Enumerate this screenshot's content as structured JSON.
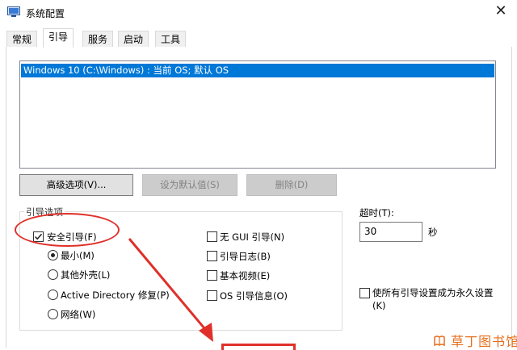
{
  "window": {
    "title": "系统配置",
    "close_glyph": "✕"
  },
  "tabs": [
    {
      "label": "常规"
    },
    {
      "label": "引导"
    },
    {
      "label": "服务"
    },
    {
      "label": "启动"
    },
    {
      "label": "工具"
    }
  ],
  "active_tab": "引导",
  "os_list": {
    "selected_item": "Windows 10 (C:\\Windows) : 当前 OS; 默认 OS"
  },
  "buttons": {
    "advanced": "高级选项(V)...",
    "set_default": "设为默认值(S)",
    "delete": "删除(D)"
  },
  "boot_options": {
    "group_label": "引导选项",
    "safe_boot": {
      "label": "安全引导(F)",
      "checked": true
    },
    "minimal": {
      "label": "最小(M)",
      "checked": true
    },
    "alternate_shell": {
      "label": "其他外壳(L)",
      "checked": false
    },
    "ad_repair": {
      "label": "Active Directory 修复(P)",
      "checked": false
    },
    "network": {
      "label": "网络(W)",
      "checked": false
    },
    "no_gui": {
      "label": "无 GUI 引导(N)",
      "checked": false
    },
    "boot_log": {
      "label": "引导日志(B)",
      "checked": false
    },
    "base_video": {
      "label": "基本视频(E)",
      "checked": false
    },
    "os_boot_info": {
      "label": "OS 引导信息(O)",
      "checked": false
    }
  },
  "timeout": {
    "label": "超时(T):",
    "value": "30",
    "unit": "秒"
  },
  "permanent": {
    "label_line1": "使所有引导设置成为永久设置",
    "label_line2": "(K)",
    "checked": false
  },
  "annotation": {
    "highlight_color": "#e0302a"
  },
  "watermark": {
    "text": "草丁图书馆"
  }
}
